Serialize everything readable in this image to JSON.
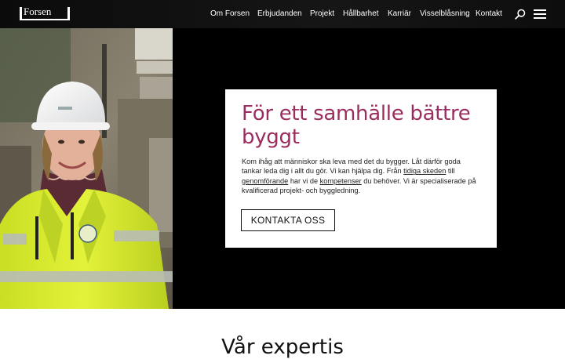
{
  "header": {
    "logo_text": "Forsen",
    "nav": [
      {
        "label": "Om Forsen"
      },
      {
        "label": "Erbjudanden"
      },
      {
        "label": "Projekt"
      },
      {
        "label": "Hållbarhet"
      },
      {
        "label": "Karriär"
      },
      {
        "label": "Visselblåsning"
      },
      {
        "label": "Kontakt"
      }
    ],
    "search_icon": "search-icon",
    "menu_icon": "hamburger-menu-icon"
  },
  "hero": {
    "image": "woman-in-hard-hat-and-hi-vis-jacket",
    "title": "För ett samhälle bättre byggt",
    "body": {
      "t1": "Kom ihåg att människor ska leva med det du bygger. Låt därför goda tankar leda dig i allt du gör. Vi kan hjälpa dig. Från ",
      "link1": "tidiga skeden",
      "t2": " till ",
      "link2": "genomförande",
      "t3": " har vi de ",
      "link3": "kompetenser",
      "t4": " du behöver. Vi är specialiserade på kvalificerad projekt- och byggledning."
    },
    "cta_label": "KONTAKTA OSS"
  },
  "expertise": {
    "title": "Vår expertis"
  },
  "colors": {
    "accent": "#9b2d5e",
    "header_bg": "#111111",
    "hero_bg": "#000000"
  }
}
